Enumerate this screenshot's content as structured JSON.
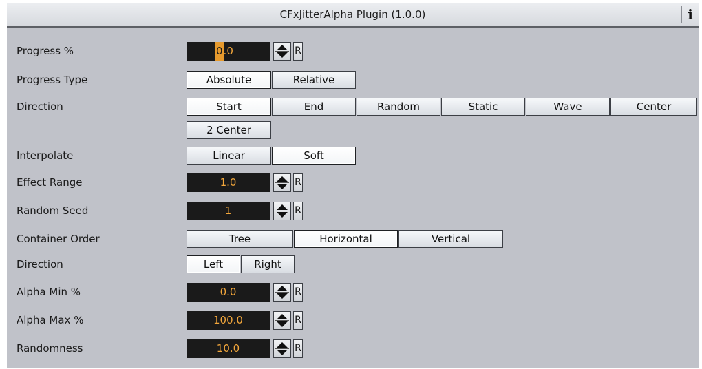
{
  "title": "CFxJitterAlpha Plugin (1.0.0)",
  "info_icon": "i",
  "reset_label": "R",
  "rows": {
    "progress": {
      "label": "Progress %",
      "value_sel": "0",
      "value_rest": ".0"
    },
    "progress_type": {
      "label": "Progress Type",
      "options": [
        "Absolute",
        "Relative"
      ],
      "selected": "Absolute"
    },
    "direction": {
      "label": "Direction",
      "options": [
        "Start",
        "End",
        "Random",
        "Static",
        "Wave",
        "Center",
        "2 Center"
      ],
      "selected": "Start"
    },
    "interpolate": {
      "label": "Interpolate",
      "options": [
        "Linear",
        "Soft"
      ],
      "selected": "Soft"
    },
    "effect_range": {
      "label": "Effect Range",
      "value": "1.0"
    },
    "random_seed": {
      "label": "Random Seed",
      "value": "1"
    },
    "container_order": {
      "label": "Container Order",
      "options": [
        "Tree",
        "Horizontal",
        "Vertical"
      ],
      "selected": "Horizontal"
    },
    "direction2": {
      "label": "Direction",
      "options": [
        "Left",
        "Right"
      ],
      "selected": "Left"
    },
    "alpha_min": {
      "label": "Alpha Min %",
      "value": "0.0"
    },
    "alpha_max": {
      "label": "Alpha Max %",
      "value": "100.0"
    },
    "randomness": {
      "label": "Randomness",
      "value": "10.0"
    }
  },
  "colors": {
    "panel": "#c0c2c9",
    "field_bg": "#1a1a1a",
    "field_text": "#f2a63b"
  }
}
